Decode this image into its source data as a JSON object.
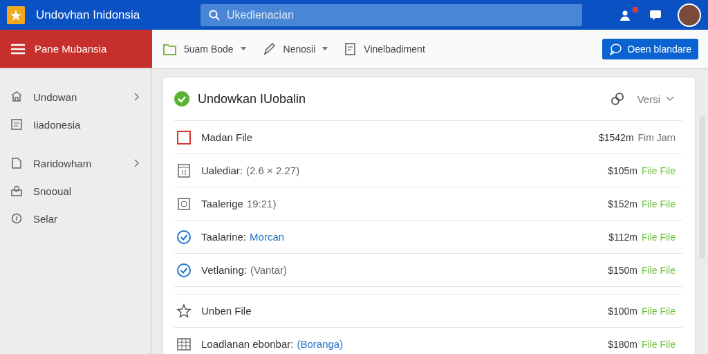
{
  "header": {
    "title": "Undovhan Inidonsia",
    "search": {
      "placeholder": "Ukedlenacian"
    },
    "notification_badge": true
  },
  "panel": {
    "title": "Pane Mubansia"
  },
  "toolbar": {
    "items": [
      {
        "label": "5uam Bode",
        "dropdown": true
      },
      {
        "label": "Nenosii",
        "dropdown": true
      },
      {
        "label": "Vinelbadiment",
        "dropdown": false
      }
    ],
    "action": "Oeen blandare"
  },
  "sidebar": {
    "items": [
      {
        "label": "Undowan",
        "expandable": true
      },
      {
        "label": "Iiadonesia",
        "expandable": false
      },
      {
        "label": "Raridowham",
        "expandable": true
      },
      {
        "label": "Snooual",
        "expandable": false
      },
      {
        "label": "Selar",
        "expandable": false
      }
    ]
  },
  "card": {
    "title": "Undowkan IUobalin",
    "version": "Versi",
    "groups": [
      [
        {
          "kind": "square",
          "label": "Madan File",
          "link": false,
          "amount": "$1542m",
          "status": "Fim Jarn",
          "color": "#6f6f6f"
        },
        {
          "kind": "calendar",
          "label": "Ualediar:",
          "note": "(2.6 × 2.27)",
          "link": false,
          "amount": "$105m",
          "status": "File File",
          "color": "#6cbf3f"
        },
        {
          "kind": "image",
          "label": "Taalerige",
          "note": "19:21)",
          "link": false,
          "amount": "$152m",
          "status": "File File",
          "color": "#6cbf3f"
        },
        {
          "kind": "check",
          "label": "Taalarine:",
          "note": "Morcan",
          "link": true,
          "amount": "$112m",
          "status": "File File",
          "color": "#6cbf3f"
        },
        {
          "kind": "check",
          "label": "Vetlaning:",
          "note": "(Vantar)",
          "link": false,
          "amount": "$150m",
          "status": "File File",
          "color": "#6cbf3f"
        }
      ],
      [
        {
          "kind": "star",
          "label": "Unben File",
          "link": false,
          "amount": "$100m",
          "status": "File File",
          "color": "#6cbf3f"
        },
        {
          "kind": "grid",
          "label": "Loadlanan ebonbar:",
          "note": "(Boranga)",
          "link": true,
          "amount": "$180m",
          "status": "File File",
          "color": "#6cbf3f"
        }
      ]
    ]
  }
}
